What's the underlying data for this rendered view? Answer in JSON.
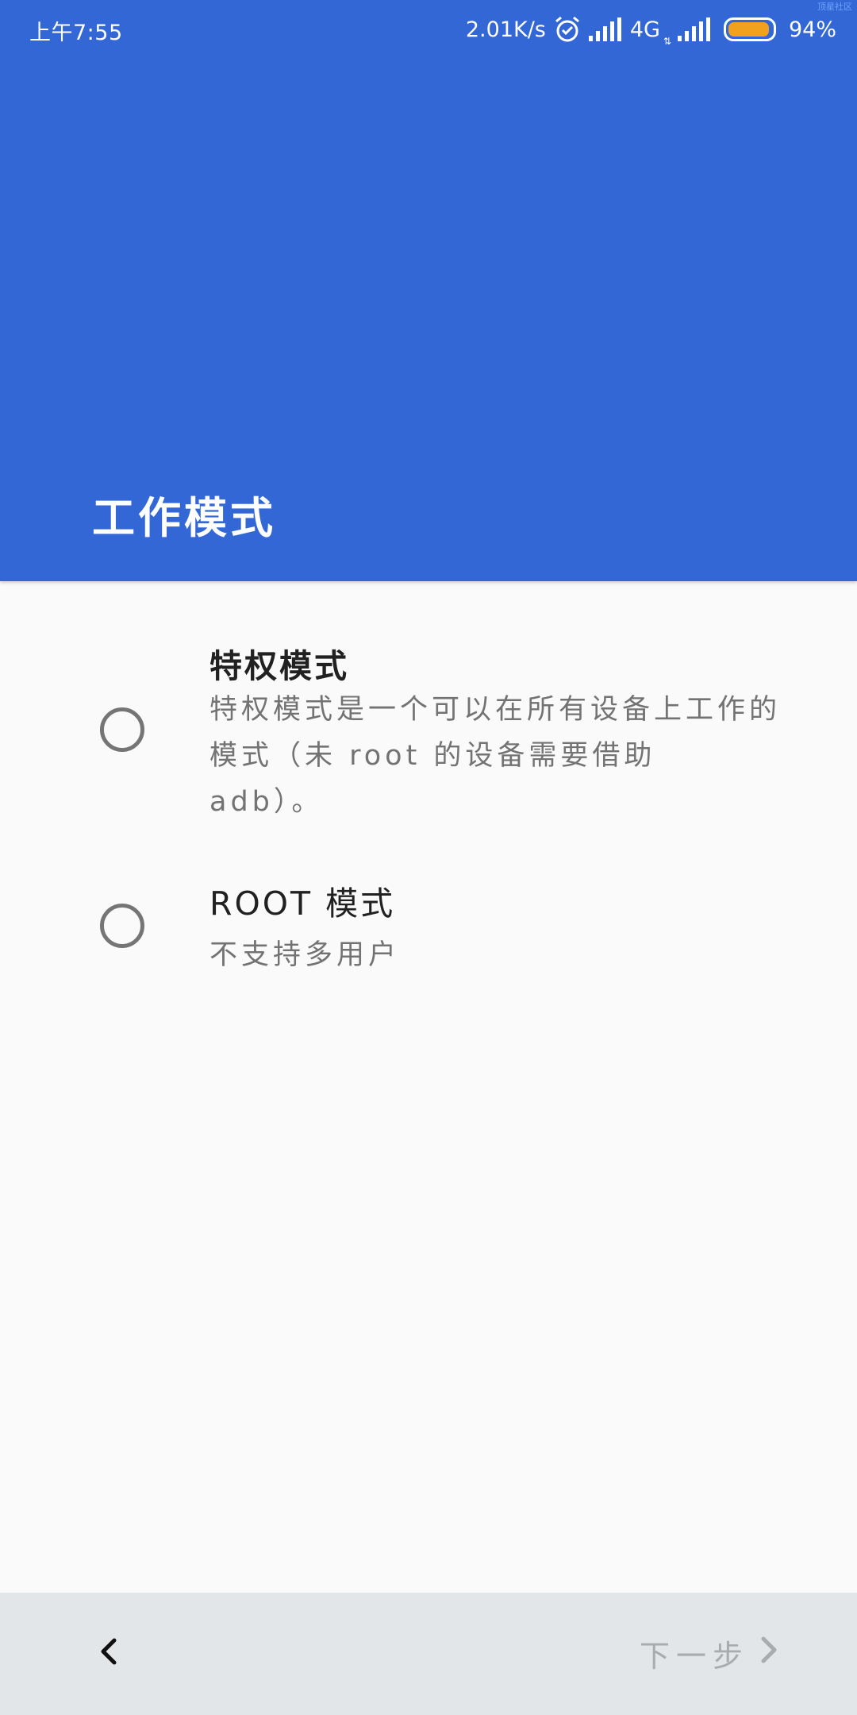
{
  "status_bar": {
    "time": "上午7:55",
    "net_speed": "2.01K/s",
    "network_type": "4G",
    "network_arrows": "⇅",
    "battery_percent": "94%",
    "battery_level": 0.94,
    "watermark": "顶星社区"
  },
  "header": {
    "title": "工作模式",
    "background_color": "#3367d6"
  },
  "options": [
    {
      "title": "特权模式",
      "description": "特权模式是一个可以在所有设备上工作的模式（未 root 的设备需要借助 adb）。",
      "selected": false
    },
    {
      "title": "ROOT 模式",
      "description": "不支持多用户",
      "selected": false
    }
  ],
  "bottom_nav": {
    "back_icon": "chevron-left-icon",
    "next_label": "下一步",
    "next_icon": "chevron-right-icon",
    "next_enabled": false
  }
}
